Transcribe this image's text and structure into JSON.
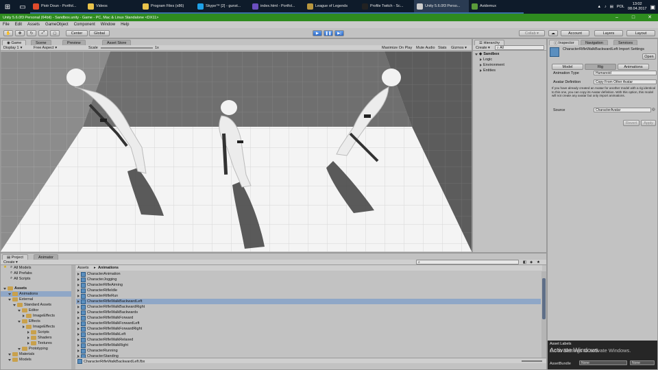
{
  "taskbar": {
    "tasks": [
      {
        "label": "Piotr Doun - Portfol...",
        "color": "#e04b2c",
        "active": false
      },
      {
        "label": "Videos",
        "color": "#e8c24a",
        "active": false
      },
      {
        "label": "Program Files (x86)",
        "color": "#e8c24a",
        "active": false
      },
      {
        "label": "Skype™ [2] - gunst...",
        "color": "#1ea0e6",
        "active": false
      },
      {
        "label": "index.html - Portfol...",
        "color": "#6b4fbf",
        "active": false
      },
      {
        "label": "League of Legends",
        "color": "#b8963e",
        "active": false
      },
      {
        "label": "Profile Twitch - Sc...",
        "color": "#222222",
        "active": false
      },
      {
        "label": "Unity 5.6.0f3 Perso...",
        "color": "#cccccc",
        "active": true
      },
      {
        "label": "Avidemux",
        "color": "#5a9a3a",
        "active": false
      }
    ],
    "language": "POL",
    "time": "13:02",
    "date": "08.04.2017"
  },
  "window": {
    "title": "Unity 5.6.0f3 Personal (64bit) - Sandbox.unity - Game - PC, Mac & Linux Standalone <DX11>",
    "controls": [
      "–",
      "□",
      "✕"
    ]
  },
  "menubar": [
    "File",
    "Edit",
    "Assets",
    "GameObject",
    "Component",
    "Window",
    "Help"
  ],
  "toolbar": {
    "pivot": "Center",
    "space": "Global",
    "collab": "Collab ▾",
    "account": "Account",
    "layers": "Layers",
    "layout": "Layout"
  },
  "game_view": {
    "tabs": [
      "Game",
      "Scene",
      "Preview",
      "Asset Store"
    ],
    "display": "Display 1",
    "aspect": "Free Aspect",
    "scale_label": "Scale",
    "scale_value": "1x",
    "options": [
      "Maximize On Play",
      "Mute Audio",
      "Stats",
      "Gizmos ▾"
    ]
  },
  "hierarchy": {
    "tab": "Hierarchy",
    "create": "Create ▾",
    "search": "All",
    "scene": "Sandbox",
    "items": [
      "Logic",
      "Environment",
      "Entities"
    ]
  },
  "inspector": {
    "tabs": [
      "Inspector",
      "Navigation",
      "Services"
    ],
    "object_name": "CharacterRifleWalkBackwardLeft Import Settings",
    "open_button": "Open",
    "subtabs": [
      "Model",
      "Rig",
      "Animations"
    ],
    "animation_type_label": "Animation Type",
    "animation_type_value": "Humanoid",
    "avatar_definition_label": "Avatar Definition",
    "avatar_definition_value": "Copy From Other Avatar",
    "help_text": "If you have already created an Avatar for another model with a rig identical to this one, you can copy its Avatar definition. With this option, this model will not create any avatar but only import animations.",
    "source_label": "Source",
    "source_value": "CharacterAvatar",
    "revert_button": "Revert",
    "apply_button": "Apply",
    "asset_labels": "Asset Labels",
    "assetbundle_label": "AssetBundle",
    "assetbundle_value": "None",
    "assetbundle_variant": "None"
  },
  "project": {
    "tabs": [
      "Project",
      "Animator"
    ],
    "create": "Create ▾",
    "favorites": [
      "All Models",
      "All Prefabs",
      "All Scripts"
    ],
    "tree": [
      {
        "label": "Assets",
        "depth": 0,
        "bold": true
      },
      {
        "label": "Animations",
        "depth": 1,
        "selected": true
      },
      {
        "label": "External",
        "depth": 1
      },
      {
        "label": "Standard Assets",
        "depth": 2
      },
      {
        "label": "Editor",
        "depth": 3
      },
      {
        "label": "ImageEffects",
        "depth": 4
      },
      {
        "label": "Effects",
        "depth": 3
      },
      {
        "label": "ImageEffects",
        "depth": 4
      },
      {
        "label": "Scripts",
        "depth": 5
      },
      {
        "label": "Shaders",
        "depth": 5
      },
      {
        "label": "Textures",
        "depth": 5
      },
      {
        "label": "Prototyping",
        "depth": 3
      },
      {
        "label": "Materials",
        "depth": 1
      },
      {
        "label": "Models",
        "depth": 1
      }
    ],
    "breadcrumb": [
      "Assets",
      "Animations"
    ],
    "files": [
      "CharacterAnimation",
      "CharacterJogging",
      "CharacterRifleAiming",
      "CharacterRifleIdle",
      "CharacterRifleRun",
      "CharacterRifleWalkBackwardLeft",
      "CharacterRifleWalkBackwardRight",
      "CharacterRifleWalkBackwards",
      "CharacterRifleWalkForward",
      "CharacterRifleWalkForwardLeft",
      "CharacterRifleWalkForwardRight",
      "CharacterRifleWalkLeft",
      "CharacterRifleWalkRelaxed",
      "CharacterRifleWalkRight",
      "CharacterRunning",
      "CharacterStanding"
    ],
    "selected_index": 5,
    "footer": "CharacterRifleWalkBackwardLeft.fbx"
  },
  "windows_watermark": {
    "line1": "Activate Windows",
    "line2": "Go to Settings to activate Windows."
  }
}
